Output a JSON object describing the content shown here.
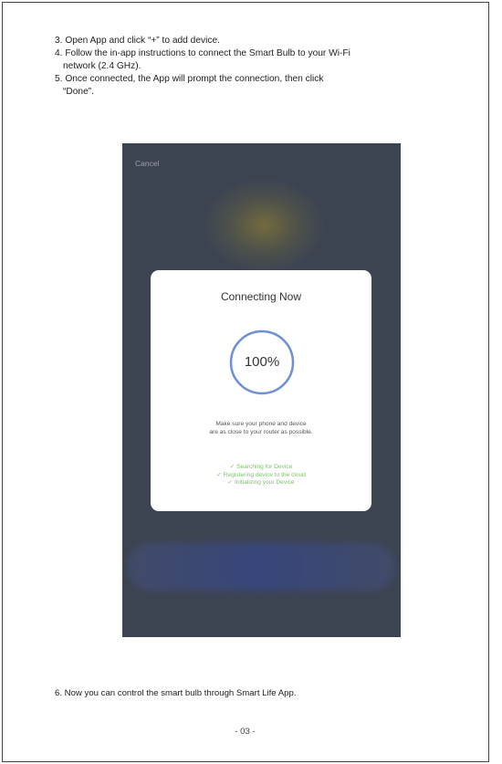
{
  "instructions": {
    "step3": "3. Open App and click “+” to add device.",
    "step4_line1": "4. Follow the in-app instructions to connect the Smart Bulb to your Wi-Fi",
    "step4_line2": "network (2.4 GHz).",
    "step5_line1": "5. Once connected, the App will prompt the connection, then click",
    "step5_line2": "“Done”."
  },
  "phone": {
    "cancel_label": "Cancel",
    "dialog": {
      "title": "Connecting Now",
      "progress_text": "100%",
      "progress_fraction": 1.0,
      "progress_color": "#6f8fd8",
      "hint_line1": "Make sure your phone and device",
      "hint_line2": "are as close to your router as possible.",
      "status_color": "#7cc36a",
      "status_items": [
        "Searching for Device",
        "Registering device to the cloud",
        "Initializing your Device"
      ]
    }
  },
  "footer_note": "6. Now you can control the smart bulb through Smart Life App.",
  "page_number": "- 03 -"
}
